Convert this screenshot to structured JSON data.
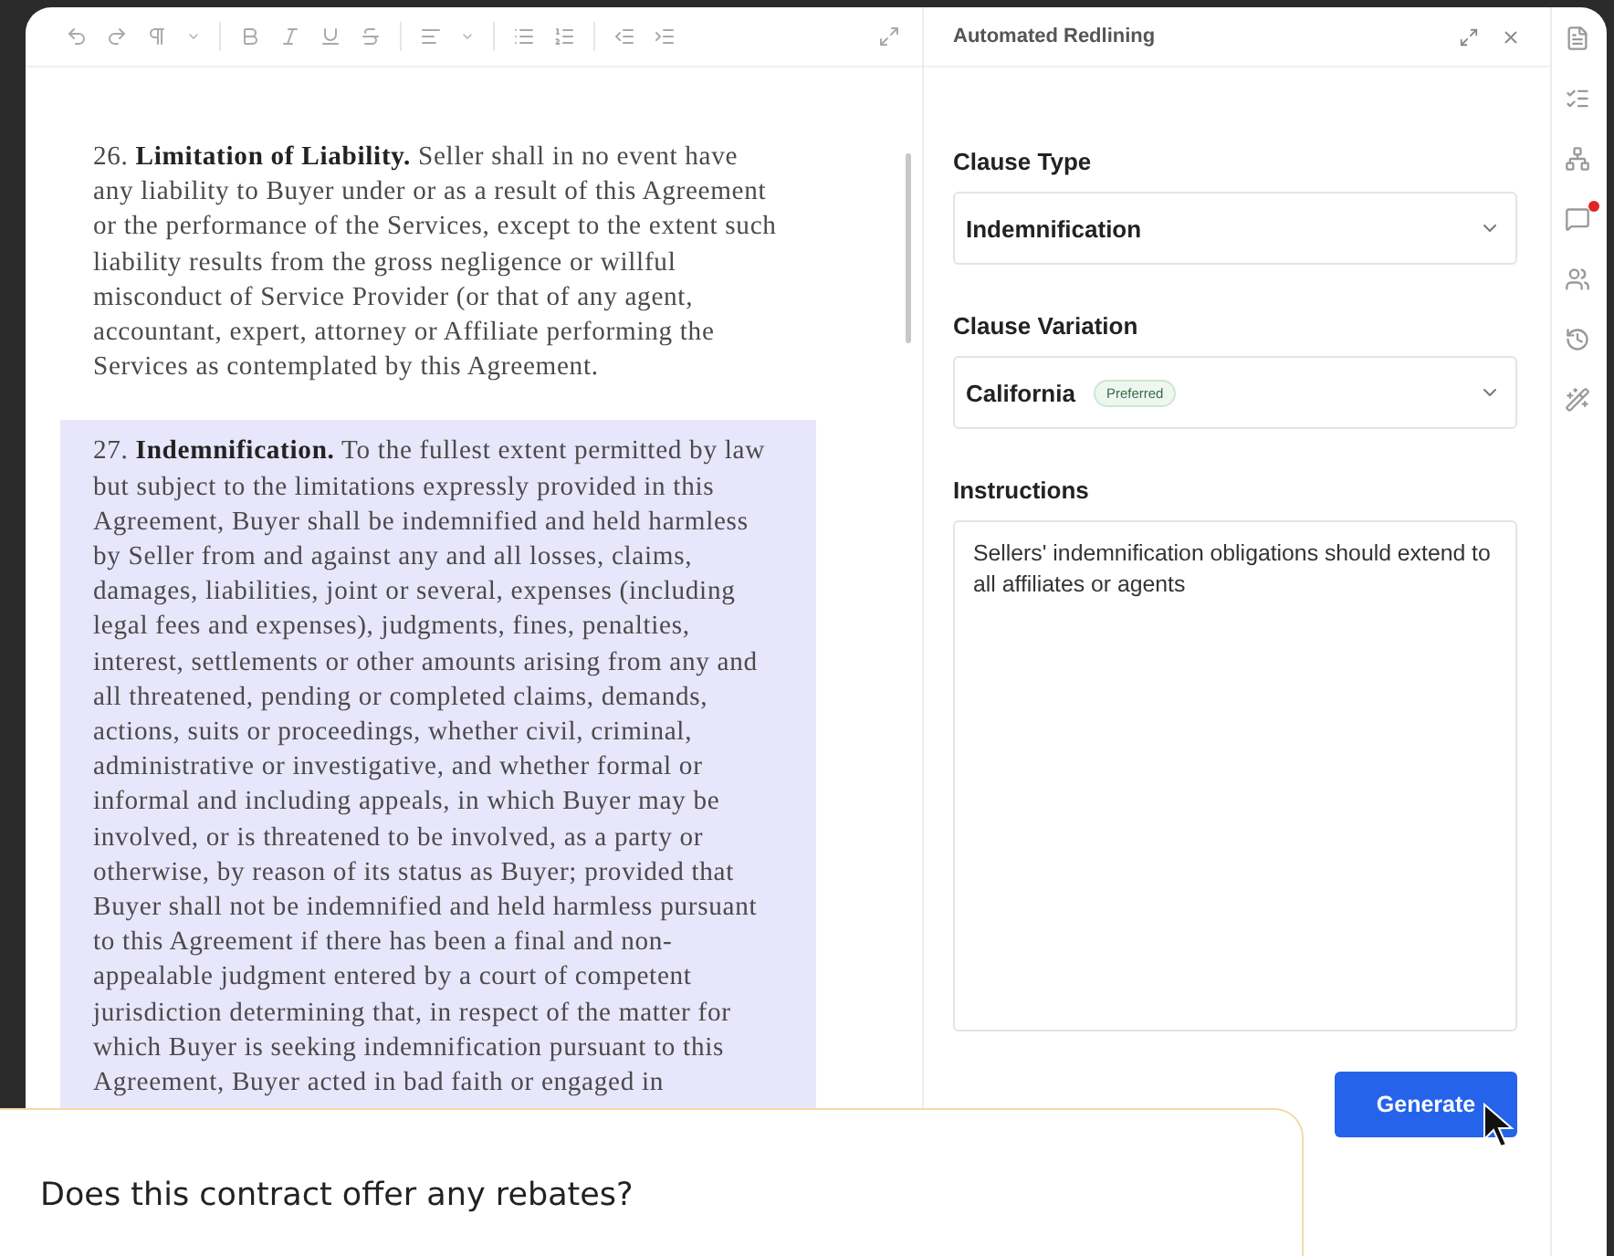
{
  "document": {
    "paragraphs": [
      {
        "number": "26.",
        "heading": "Limitation of Liability.",
        "body": "Seller shall in no event have any liability to Buyer under or as a result of this Agreement or the performance of the Services, except to the extent such liability results from the gross negligence or willful misconduct of Service Provider (or that of any agent, accountant, expert, attorney or Affiliate performing the Services as contemplated by this Agreement.",
        "highlighted": false
      },
      {
        "number": "27.",
        "heading": "Indemnification.",
        "body": "To the fullest extent permitted by law but subject to the limitations expressly provided in this Agreement, Buyer shall be indemnified and held harmless by Seller from and against any and all losses, claims, damages, liabilities, joint or several, expenses (including legal fees and expenses), judgments, fines, penalties, interest, settlements or other amounts arising from any and all threatened, pending or completed claims, demands, actions, suits or proceedings, whether civil, criminal, administrative or investigative, and whether formal or informal and including appeals, in which Buyer may be involved, or is threatened to be involved, as a party or otherwise, by reason of its status as Buyer; provided that Buyer shall not be indemnified and held harmless pursuant to this Agreement if there has been a final and non-appealable judgment entered by a court of competent jurisdiction determining that, in respect of the matter for which Buyer is seeking indemnification pursuant to this Agreement, Buyer acted in bad faith or engaged in",
        "highlighted": true
      }
    ]
  },
  "panel": {
    "title": "Automated Redlining",
    "clause_type": {
      "label": "Clause Type",
      "value": "Indemnification"
    },
    "clause_variation": {
      "label": "Clause Variation",
      "value": "California",
      "tag": "Preferred"
    },
    "instructions": {
      "label": "Instructions",
      "value": "Sellers' indemnification obligations should extend to all affiliates or agents"
    },
    "button": "Generate"
  },
  "rail": [
    {
      "kind": "document",
      "badge": false
    },
    {
      "kind": "checklist",
      "badge": false
    },
    {
      "kind": "tree",
      "badge": false
    },
    {
      "kind": "comments",
      "badge": true
    },
    {
      "kind": "people",
      "badge": false
    },
    {
      "kind": "history",
      "badge": false
    },
    {
      "kind": "wand",
      "badge": false
    }
  ],
  "chat": {
    "question": "Does this contract offer any rebates?"
  }
}
